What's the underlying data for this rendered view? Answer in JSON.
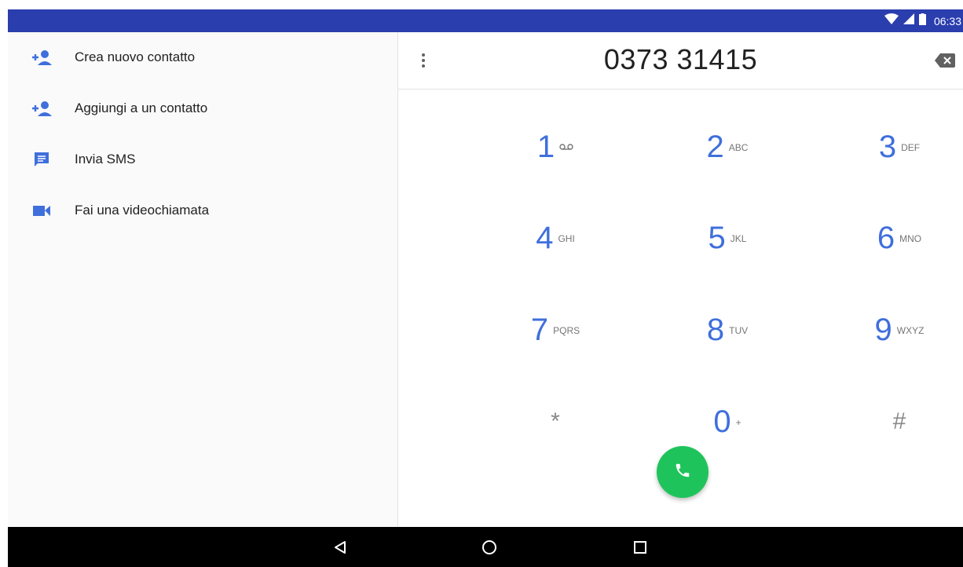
{
  "status_bar": {
    "time": "06:33",
    "icons": [
      "wifi-icon",
      "signal-icon",
      "battery-icon"
    ]
  },
  "actions": [
    {
      "label": "Crea nuovo contatto",
      "icon": "add-person-icon"
    },
    {
      "label": "Aggiungi a un contatto",
      "icon": "add-person-icon"
    },
    {
      "label": "Invia SMS",
      "icon": "message-icon"
    },
    {
      "label": "Fai una videochiamata",
      "icon": "videocam-icon"
    }
  ],
  "dialer": {
    "number": "0373 31415",
    "keys": [
      {
        "digit": "1",
        "letters": "ꝏ"
      },
      {
        "digit": "2",
        "letters": "ABC"
      },
      {
        "digit": "3",
        "letters": "DEF"
      },
      {
        "digit": "4",
        "letters": "GHI"
      },
      {
        "digit": "5",
        "letters": "JKL"
      },
      {
        "digit": "6",
        "letters": "MNO"
      },
      {
        "digit": "7",
        "letters": "PQRS"
      },
      {
        "digit": "8",
        "letters": "TUV"
      },
      {
        "digit": "9",
        "letters": "WXYZ"
      },
      {
        "digit": "*",
        "letters": ""
      },
      {
        "digit": "0",
        "letters": "+"
      },
      {
        "digit": "#",
        "letters": ""
      }
    ]
  },
  "colors": {
    "status_bar": "#2a3eae",
    "accent": "#3f6fdc",
    "call_button": "#1ec45b",
    "nav_bar": "#000000"
  },
  "nav": [
    "back-icon",
    "home-icon",
    "recents-icon"
  ]
}
